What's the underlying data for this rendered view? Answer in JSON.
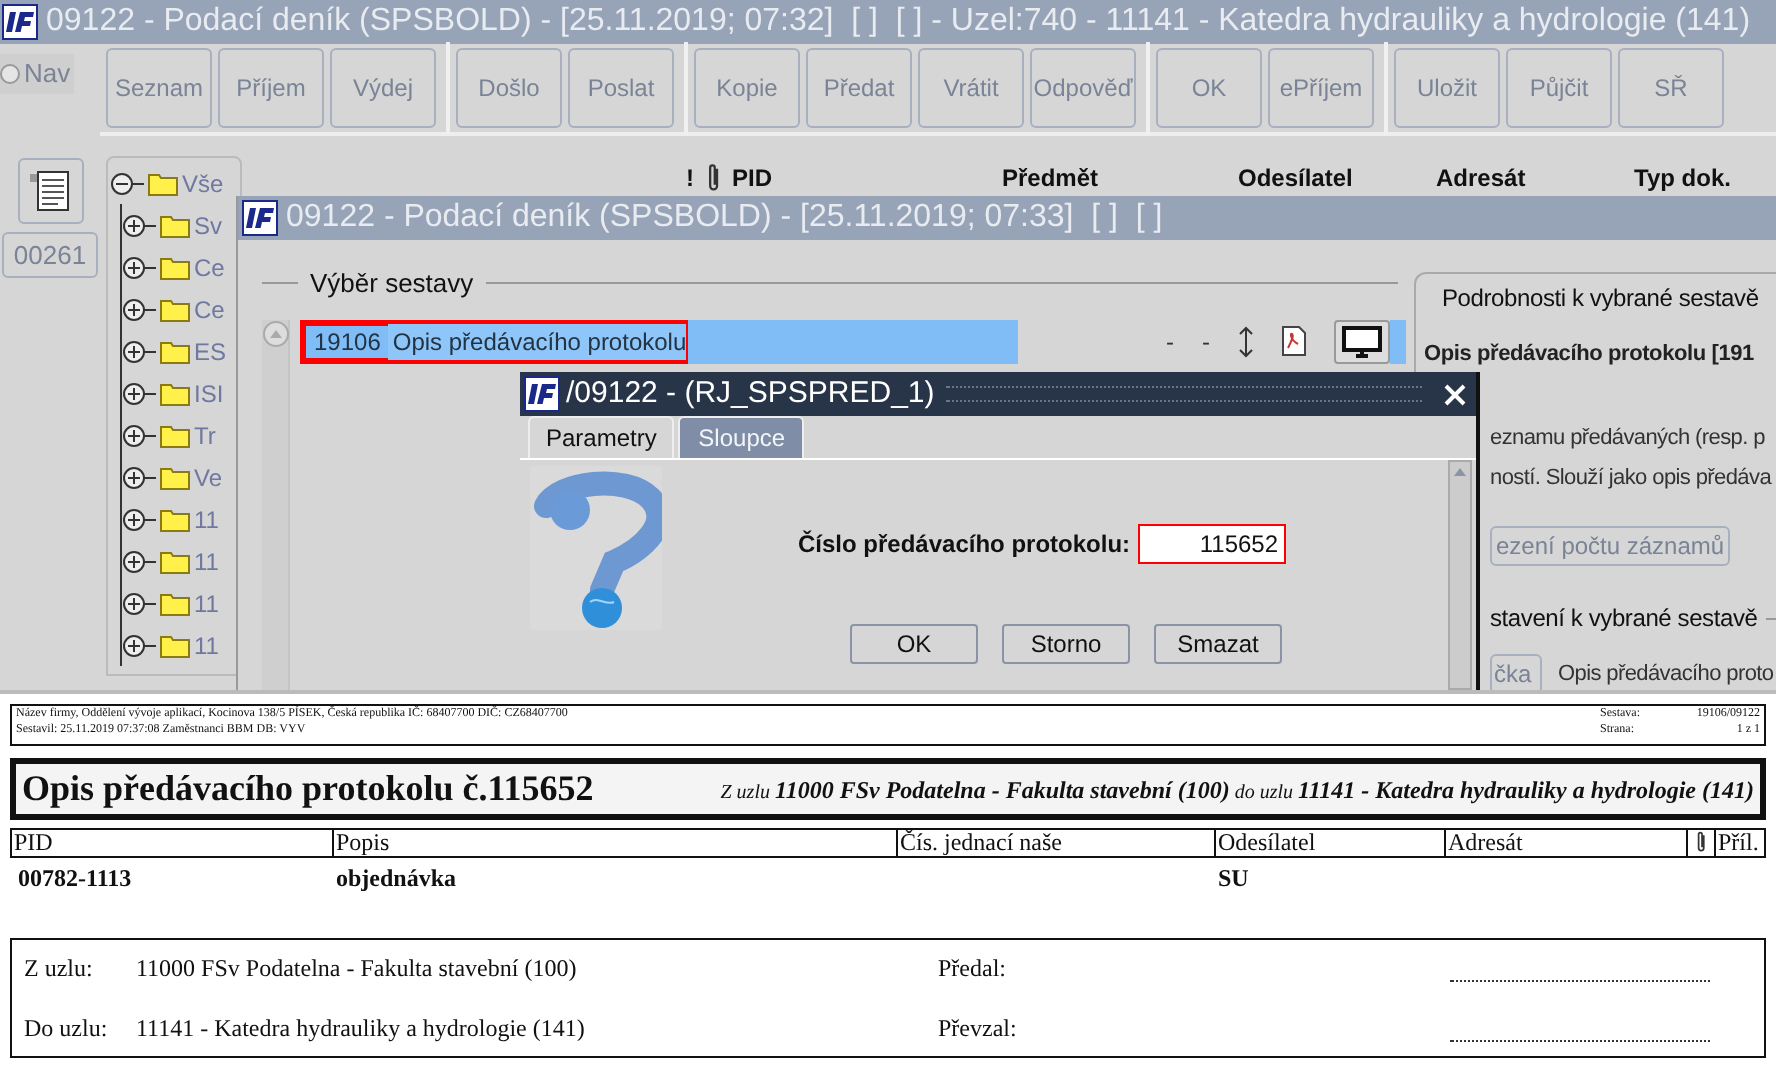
{
  "main_window": {
    "title": "09122 - Podací deník (SPSBOLD) - [25.11.2019; 07:32]  [ ]  [ ] - Uzel:740 - 11141 - Katedra hydrauliky a hydrologie (141)",
    "nav": {
      "label": "Nav",
      "selected": false
    },
    "counter": "00261",
    "toolbar_groups": [
      {
        "buttons": [
          "Seznam",
          "Příjem",
          "Výdej"
        ]
      },
      {
        "buttons": [
          "Došlo",
          "Poslat"
        ]
      },
      {
        "buttons": [
          "Kopie",
          "Předat",
          "Vrátit",
          "Odpověď"
        ]
      },
      {
        "buttons": [
          "OK",
          "ePříjem"
        ]
      },
      {
        "buttons": [
          "Uložit",
          "Půjčit",
          "SŘ"
        ]
      }
    ],
    "tree": {
      "label": "Vše",
      "expanded": true,
      "children": [
        {
          "label": "Sv",
          "expanded": false
        },
        {
          "label": "Ce",
          "expanded": false
        },
        {
          "label": "Ce",
          "expanded": false
        },
        {
          "label": "ES",
          "expanded": false
        },
        {
          "label": "ISI",
          "expanded": false
        },
        {
          "label": "Tr",
          "expanded": false
        },
        {
          "label": "Ve",
          "expanded": false
        },
        {
          "label": "11",
          "expanded": false
        },
        {
          "label": "11",
          "expanded": false
        },
        {
          "label": "11",
          "expanded": false
        },
        {
          "label": "11",
          "expanded": false
        }
      ]
    },
    "columns": [
      "!",
      "PID",
      "Předmět",
      "Odesílatel",
      "Adresát",
      "Typ dok."
    ]
  },
  "report_window": {
    "title": "09122 - Podací deník (SPSBOLD) - [25.11.2019; 07:33]  [ ]  [ ]",
    "section_title": "Výběr sestavy",
    "reports": [
      {
        "id": "19106",
        "name": "Opis předávacího protokolu",
        "selected": true,
        "column_3": "-",
        "column_4": "-"
      }
    ],
    "details": {
      "title": "Podrobnosti k vybrané sestavě",
      "heading": "Opis předávacího protokolu [191",
      "lines": [
        "eznamu předávaných (resp. p",
        "ností. Slouží jako opis předáva"
      ],
      "limit_button": "ezení počtu záznamů",
      "settings_title": "stavení k vybrané sestavě",
      "settings_button": "čka",
      "settings_value": "Opis předávacího proto"
    }
  },
  "dialog": {
    "title": "/09122 - (RJ_SPSPRED_1)",
    "tabs": [
      {
        "label": "Parametry",
        "selected": true
      },
      {
        "label": "Sloupce",
        "selected": false
      }
    ],
    "field": {
      "label": "Číslo předávacího protokolu:",
      "value": "115652"
    },
    "buttons": [
      "OK",
      "Storno",
      "Smazat"
    ]
  },
  "preview": {
    "header_lines": [
      "Název firmy, Oddělení vývoje aplikací, Kocinova 138/5 PÍSEK, Česká republika  IČ: 68407700  DIČ: CZ68407700",
      "Sestavil: 25.11.2019 07:37:08 Zaměstnanci BBM  DB: VYV"
    ],
    "meta": [
      {
        "label": "Sestava:",
        "value": "19106/09122"
      },
      {
        "label": "Strana:",
        "value": "1 z 1"
      }
    ],
    "title": "Opis předávacího protokolu č.115652",
    "subtitle": "Z uzlu **11000 FSv Podatelna - Fakulta stavební (100)** do uzlu **11141 - Katedra hydrauliky a hydrologie (141)**",
    "columns": [
      "PID",
      "Popis",
      "Čís. jednací naše",
      "Odesílatel",
      "Adresát",
      "Příl."
    ],
    "row": {
      "pid": "00782-1113",
      "popis": "objednávka",
      "odesilatel": "SU"
    },
    "nodes": [
      {
        "label": "Z uzlu:",
        "value": "11000 FSv Podatelna - Fakulta stavební (100)"
      },
      {
        "label": "Do uzlu:",
        "value": "11141 - Katedra hydrauliky a hydrologie (141)"
      }
    ],
    "signatures": [
      "Předal:",
      "Převzal:"
    ]
  }
}
